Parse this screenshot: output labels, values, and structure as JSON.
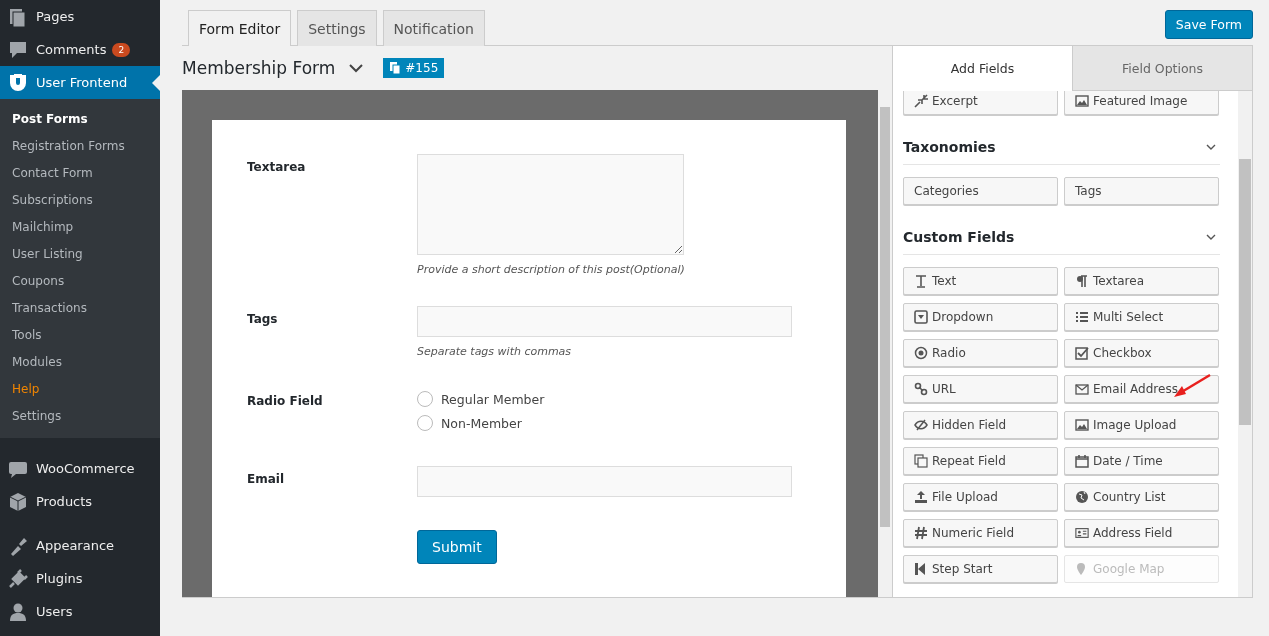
{
  "sidebar": {
    "items": [
      {
        "label": "Pages",
        "kind": "pages",
        "current": false
      },
      {
        "label": "Comments",
        "kind": "comments",
        "current": false,
        "badge": "2"
      },
      {
        "label": "User Frontend",
        "kind": "frontend",
        "current": true,
        "children": [
          {
            "label": "Post Forms",
            "selected": true,
            "kind": "normal"
          },
          {
            "label": "Registration Forms",
            "selected": false,
            "kind": "normal"
          },
          {
            "label": "Contact Form",
            "selected": false,
            "kind": "normal"
          },
          {
            "label": "Subscriptions",
            "selected": false,
            "kind": "normal"
          },
          {
            "label": "Mailchimp",
            "selected": false,
            "kind": "normal"
          },
          {
            "label": "User Listing",
            "selected": false,
            "kind": "normal"
          },
          {
            "label": "Coupons",
            "selected": false,
            "kind": "normal"
          },
          {
            "label": "Transactions",
            "selected": false,
            "kind": "normal"
          },
          {
            "label": "Tools",
            "selected": false,
            "kind": "normal"
          },
          {
            "label": "Modules",
            "selected": false,
            "kind": "normal"
          },
          {
            "label": "Help",
            "selected": false,
            "kind": "accent"
          },
          {
            "label": "Settings",
            "selected": false,
            "kind": "normal"
          }
        ]
      },
      {
        "label": "WooCommerce",
        "kind": "woo",
        "current": false
      },
      {
        "label": "Products",
        "kind": "products",
        "current": false
      },
      {
        "label": "Appearance",
        "kind": "appearance",
        "current": false
      },
      {
        "label": "Plugins",
        "kind": "plugins",
        "current": false
      },
      {
        "label": "Users",
        "kind": "users",
        "current": false
      }
    ]
  },
  "tabs": [
    {
      "label": "Form Editor",
      "selected": true
    },
    {
      "label": "Settings",
      "selected": false
    },
    {
      "label": "Notification",
      "selected": false
    }
  ],
  "save_button": "Save Form",
  "form_title": "Membership Form",
  "form_id_badge": "#155",
  "form_preview": {
    "fields": [
      {
        "kind": "textarea",
        "label": "Textarea",
        "help": "Provide a short description of this post(Optional)"
      },
      {
        "kind": "text",
        "label": "Tags",
        "help": "Separate tags with commas"
      },
      {
        "kind": "radio",
        "label": "Radio Field",
        "options": [
          {
            "label": "Regular Member",
            "selected": false
          },
          {
            "label": "Non-Member",
            "selected": false
          }
        ]
      },
      {
        "kind": "text",
        "label": "Email"
      }
    ],
    "submit": "Submit"
  },
  "panel": {
    "tabs": [
      {
        "label": "Add Fields",
        "selected": true
      },
      {
        "label": "Field Options",
        "selected": false
      }
    ],
    "sections": [
      {
        "buttons": [
          {
            "label": "Excerpt",
            "kind": "excerpt",
            "disabled": false
          },
          {
            "label": "Featured Image",
            "kind": "image",
            "disabled": false
          }
        ]
      },
      {
        "title": "Taxonomies",
        "buttons": [
          {
            "label": "Categories",
            "kind": "none",
            "disabled": false
          },
          {
            "label": "Tags",
            "kind": "none",
            "disabled": false
          }
        ]
      },
      {
        "title": "Custom Fields",
        "buttons": [
          {
            "label": "Text",
            "kind": "text",
            "disabled": false
          },
          {
            "label": "Textarea",
            "kind": "para",
            "disabled": false
          },
          {
            "label": "Dropdown",
            "kind": "dropdown",
            "disabled": false
          },
          {
            "label": "Multi Select",
            "kind": "list",
            "disabled": false
          },
          {
            "label": "Radio",
            "kind": "radio",
            "disabled": false
          },
          {
            "label": "Checkbox",
            "kind": "check",
            "disabled": false
          },
          {
            "label": "URL",
            "kind": "link",
            "disabled": false
          },
          {
            "label": "Email Address",
            "kind": "mail",
            "disabled": false
          },
          {
            "label": "Hidden Field",
            "kind": "eye",
            "disabled": false
          },
          {
            "label": "Image Upload",
            "kind": "image",
            "disabled": false
          },
          {
            "label": "Repeat Field",
            "kind": "copy",
            "disabled": false
          },
          {
            "label": "Date / Time",
            "kind": "calendar",
            "disabled": false
          },
          {
            "label": "File Upload",
            "kind": "upload",
            "disabled": false
          },
          {
            "label": "Country List",
            "kind": "globe",
            "disabled": false
          },
          {
            "label": "Numeric Field",
            "kind": "hash",
            "disabled": false
          },
          {
            "label": "Address Field",
            "kind": "card",
            "disabled": false
          },
          {
            "label": "Step Start",
            "kind": "step",
            "disabled": false
          },
          {
            "label": "Google Map",
            "kind": "pin",
            "disabled": true
          }
        ]
      }
    ]
  }
}
